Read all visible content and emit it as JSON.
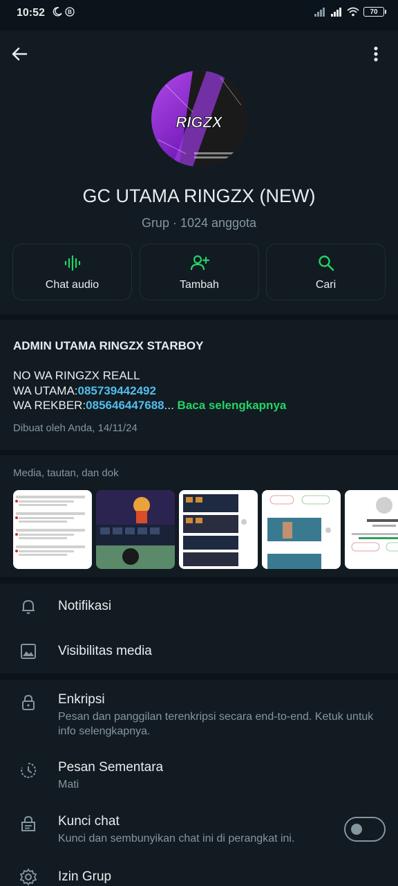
{
  "status_bar": {
    "time": "10:52",
    "battery": "70"
  },
  "header": {
    "group_name": "GC UTAMA RINGZX (NEW)",
    "group_meta": "Grup · 1024 anggota",
    "avatar_text": "RIGZX"
  },
  "actions": [
    {
      "label": "Chat audio",
      "icon": "audio-waveform-icon"
    },
    {
      "label": "Tambah",
      "icon": "add-person-icon"
    },
    {
      "label": "Cari",
      "icon": "search-icon"
    }
  ],
  "description": {
    "title": "ADMIN UTAMA RINGZX STARBOY",
    "line1": "NO WA RINGZX REALL",
    "line2_prefix": "WA UTAMA:",
    "line2_number": "085739442492",
    "line3_prefix": "WA REKBER:",
    "line3_number": "085646447688",
    "ellipsis": "...",
    "read_more": "Baca selengkapnya",
    "created": "Dibuat oleh Anda, 14/11/24"
  },
  "media": {
    "title": "Media, tautan, dan dok",
    "thumbnails": [
      "chat-screenshot",
      "game-inventory",
      "game-inventory-grid",
      "gameplay-call",
      "contact-card"
    ]
  },
  "settings": {
    "notifications": {
      "title": "Notifikasi",
      "icon": "bell-icon"
    },
    "media_visibility": {
      "title": "Visibilitas media",
      "icon": "image-icon"
    },
    "encryption": {
      "title": "Enkripsi",
      "subtitle": "Pesan dan panggilan terenkripsi secara end-to-end. Ketuk untuk info selengkapnya.",
      "icon": "lock-icon"
    },
    "disappearing": {
      "title": "Pesan Sementara",
      "subtitle": "Mati",
      "icon": "timer-icon"
    },
    "chat_lock": {
      "title": "Kunci chat",
      "subtitle": "Kunci dan sembunyikan chat ini di perangkat ini.",
      "icon": "chat-lock-icon",
      "enabled": false
    },
    "group_permissions": {
      "title": "Izin Grup",
      "icon": "gear-icon"
    }
  },
  "colors": {
    "background": "#0b141a",
    "panel": "#111b21",
    "accent_green": "#25d366",
    "link_blue": "#53bdeb",
    "text_secondary": "#8696a0"
  }
}
